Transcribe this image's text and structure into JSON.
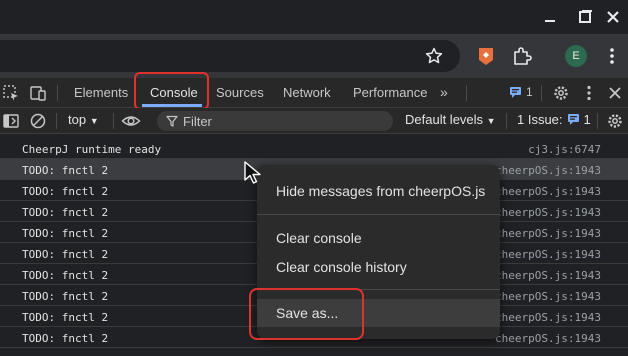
{
  "profile": {
    "initial": "E"
  },
  "devtools": {
    "tabs": [
      "Elements",
      "Console",
      "Sources",
      "Network",
      "Performance"
    ],
    "active_tab": "Console",
    "more_tabs": "»",
    "issues_badge": "1"
  },
  "toolbar": {
    "context": "top",
    "filter_placeholder": "Filter",
    "levels": "Default levels",
    "issues_label": "1 Issue:",
    "issues_count": "1"
  },
  "messages": [
    {
      "text": "CheerpJ runtime ready",
      "source": "cj3.js:6747"
    },
    {
      "text": "TODO: fnctl 2",
      "source": "cheerpOS.js:1943"
    },
    {
      "text": "TODO: fnctl 2",
      "source": "cheerpOS.js:1943"
    },
    {
      "text": "TODO: fnctl 2",
      "source": "cheerpOS.js:1943"
    },
    {
      "text": "TODO: fnctl 2",
      "source": "cheerpOS.js:1943"
    },
    {
      "text": "TODO: fnctl 2",
      "source": "cheerpOS.js:1943"
    },
    {
      "text": "TODO: fnctl 2",
      "source": "cheerpOS.js:1943"
    },
    {
      "text": "TODO: fnctl 2",
      "source": "cheerpOS.js:1943"
    },
    {
      "text": "TODO: fnctl 2",
      "source": "cheerpOS.js:1943"
    },
    {
      "text": "TODO: fnctl 2",
      "source": "cheerpOS.js:1943"
    }
  ],
  "context_menu": {
    "items": [
      "Hide messages from cheerpOS.js",
      "Clear console",
      "Clear console history",
      "Save as..."
    ]
  },
  "colors": {
    "highlight": "#e0322c",
    "active_tab_underline": "#7cacf8",
    "profile_bg": "#2d6a4f"
  }
}
